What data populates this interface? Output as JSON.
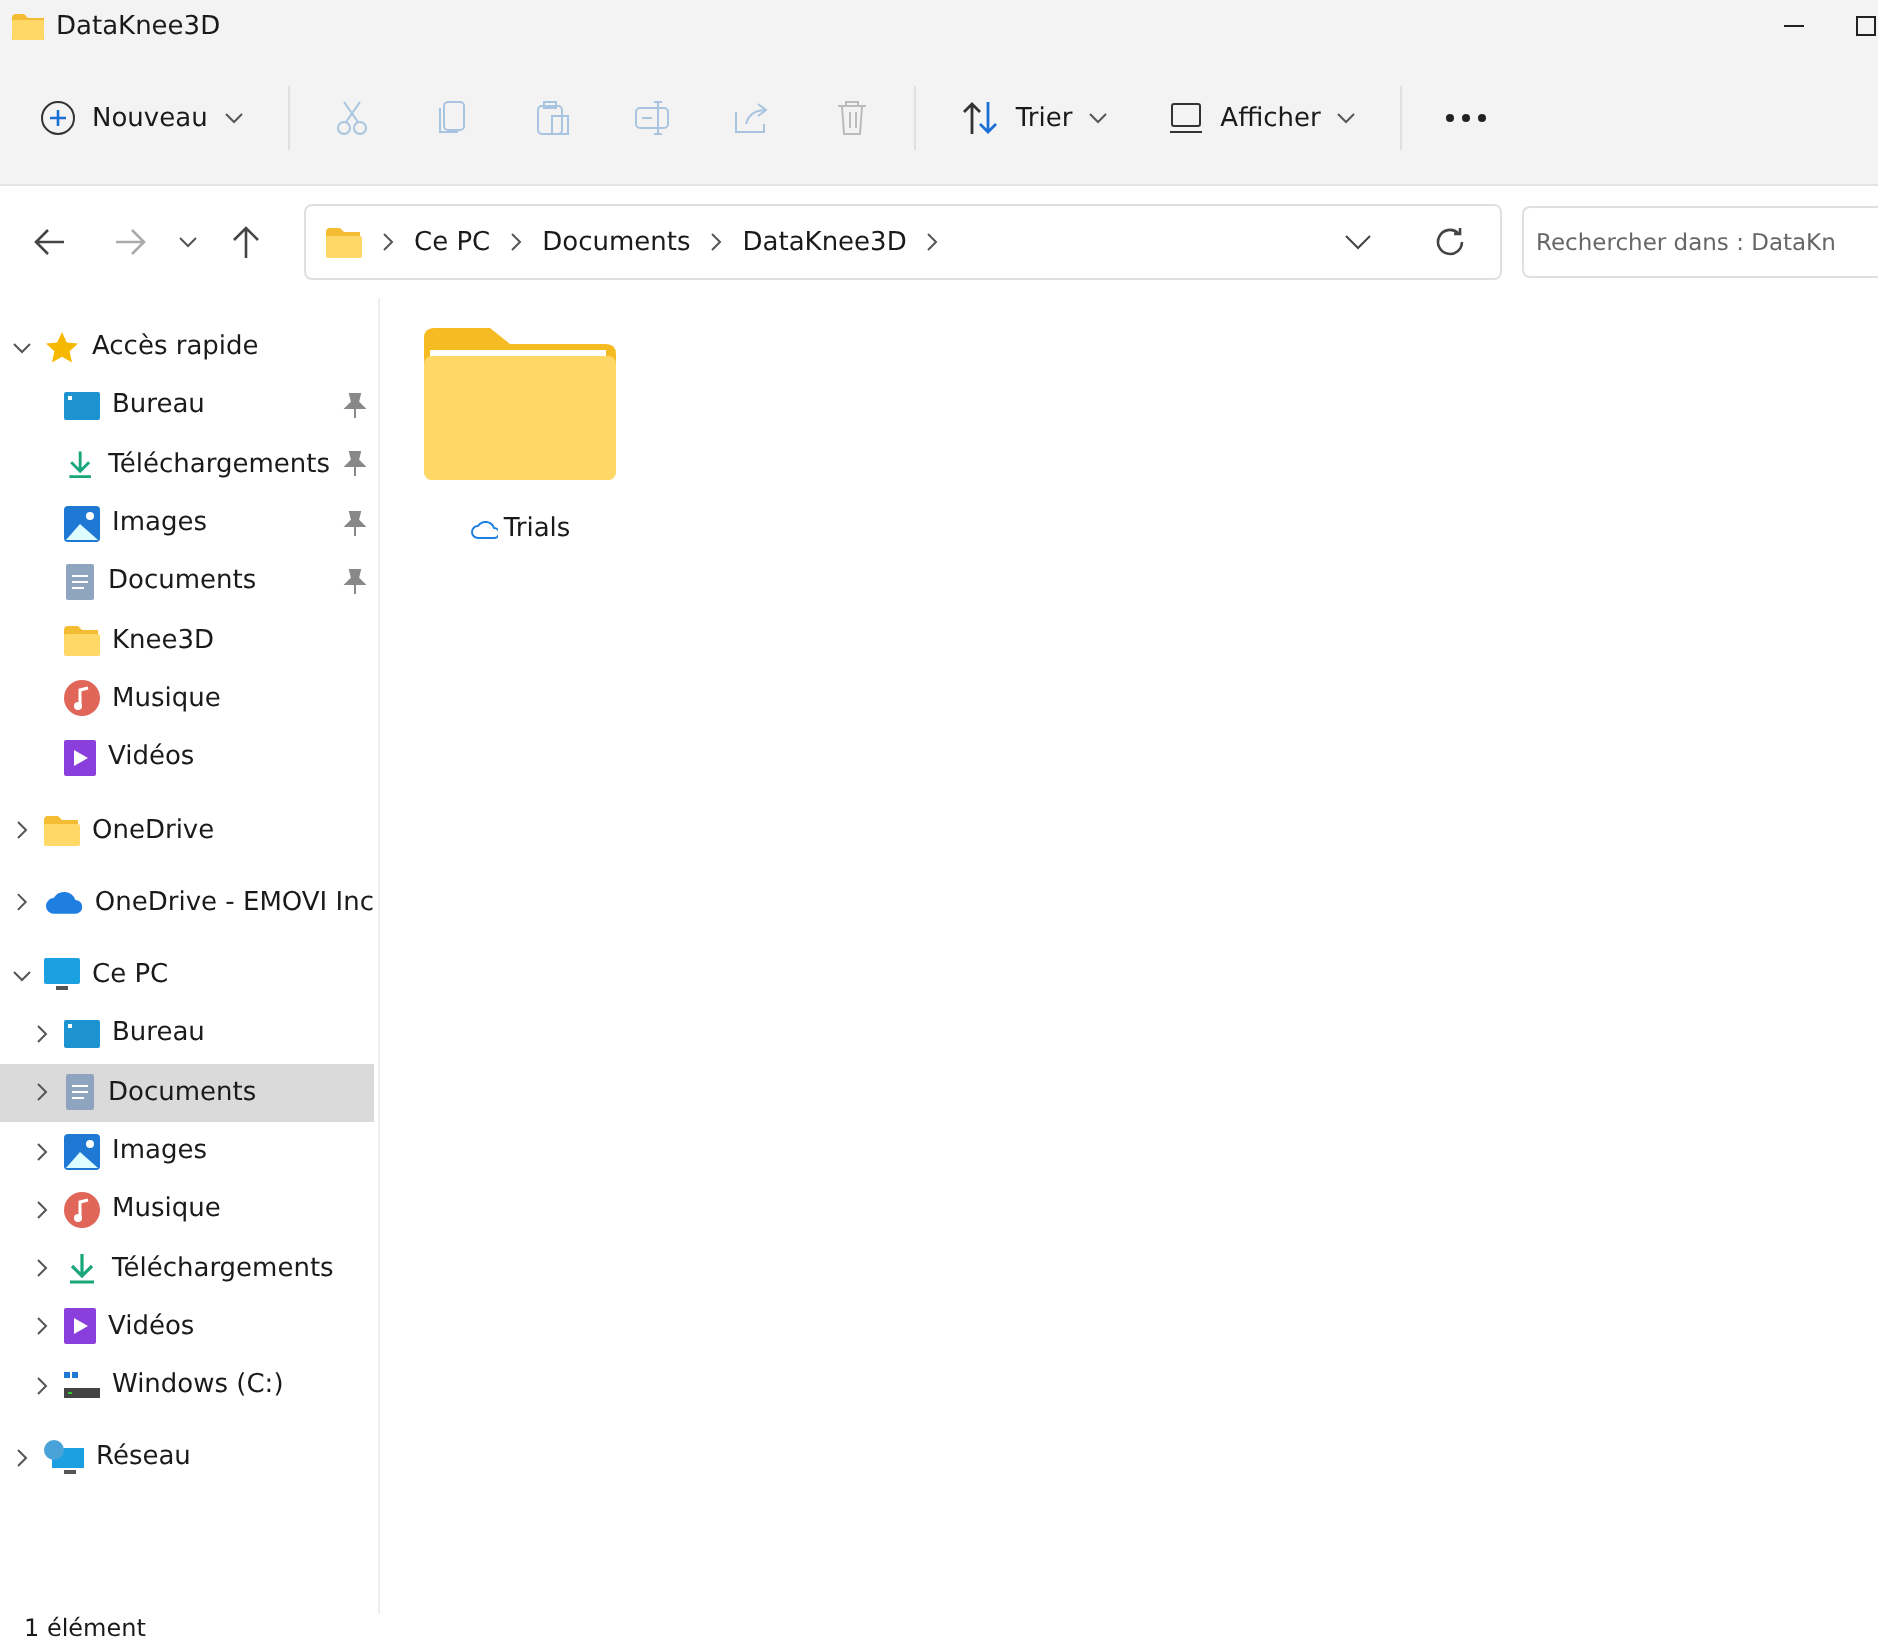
{
  "window": {
    "title": "DataKnee3D"
  },
  "toolbar": {
    "new_label": "Nouveau",
    "sort_label": "Trier",
    "view_label": "Afficher"
  },
  "address": {
    "crumbs": [
      "Ce PC",
      "Documents",
      "DataKnee3D"
    ]
  },
  "search": {
    "placeholder": "Rechercher dans : DataKn"
  },
  "sidebar": {
    "items": [
      {
        "label": "Accès rapide",
        "kind": "star",
        "expanded": true,
        "selected": false,
        "children": [
          {
            "label": "Bureau",
            "kind": "desktop",
            "pinned": true,
            "selected": false
          },
          {
            "label": "Téléchargements",
            "kind": "download",
            "pinned": true,
            "selected": false
          },
          {
            "label": "Images",
            "kind": "pictures",
            "pinned": true,
            "selected": false
          },
          {
            "label": "Documents",
            "kind": "documents",
            "pinned": true,
            "selected": false
          },
          {
            "label": "Knee3D",
            "kind": "folder",
            "pinned": false,
            "selected": false
          },
          {
            "label": "Musique",
            "kind": "music",
            "pinned": false,
            "selected": false
          },
          {
            "label": "Vidéos",
            "kind": "videos",
            "pinned": false,
            "selected": false
          }
        ]
      },
      {
        "label": "OneDrive",
        "kind": "folder",
        "expanded": false,
        "selected": false
      },
      {
        "label": "OneDrive - EMOVI Inc",
        "kind": "cloud",
        "expanded": false,
        "selected": false
      },
      {
        "label": "Ce PC",
        "kind": "pc",
        "expanded": true,
        "selected": false,
        "children": [
          {
            "label": "Bureau",
            "kind": "desktop",
            "expanded": false,
            "selected": false
          },
          {
            "label": "Documents",
            "kind": "documents",
            "expanded": false,
            "selected": true
          },
          {
            "label": "Images",
            "kind": "pictures",
            "expanded": false,
            "selected": false
          },
          {
            "label": "Musique",
            "kind": "music",
            "expanded": false,
            "selected": false
          },
          {
            "label": "Téléchargements",
            "kind": "download",
            "expanded": false,
            "selected": false
          },
          {
            "label": "Vidéos",
            "kind": "videos",
            "expanded": false,
            "selected": false
          },
          {
            "label": "Windows (C:)",
            "kind": "drive",
            "expanded": false,
            "selected": false
          }
        ]
      },
      {
        "label": "Réseau",
        "kind": "network",
        "expanded": false,
        "selected": false
      }
    ]
  },
  "files": [
    {
      "name": "Trials",
      "cloud": true
    }
  ],
  "status_bar": {
    "count": "1 élément"
  }
}
